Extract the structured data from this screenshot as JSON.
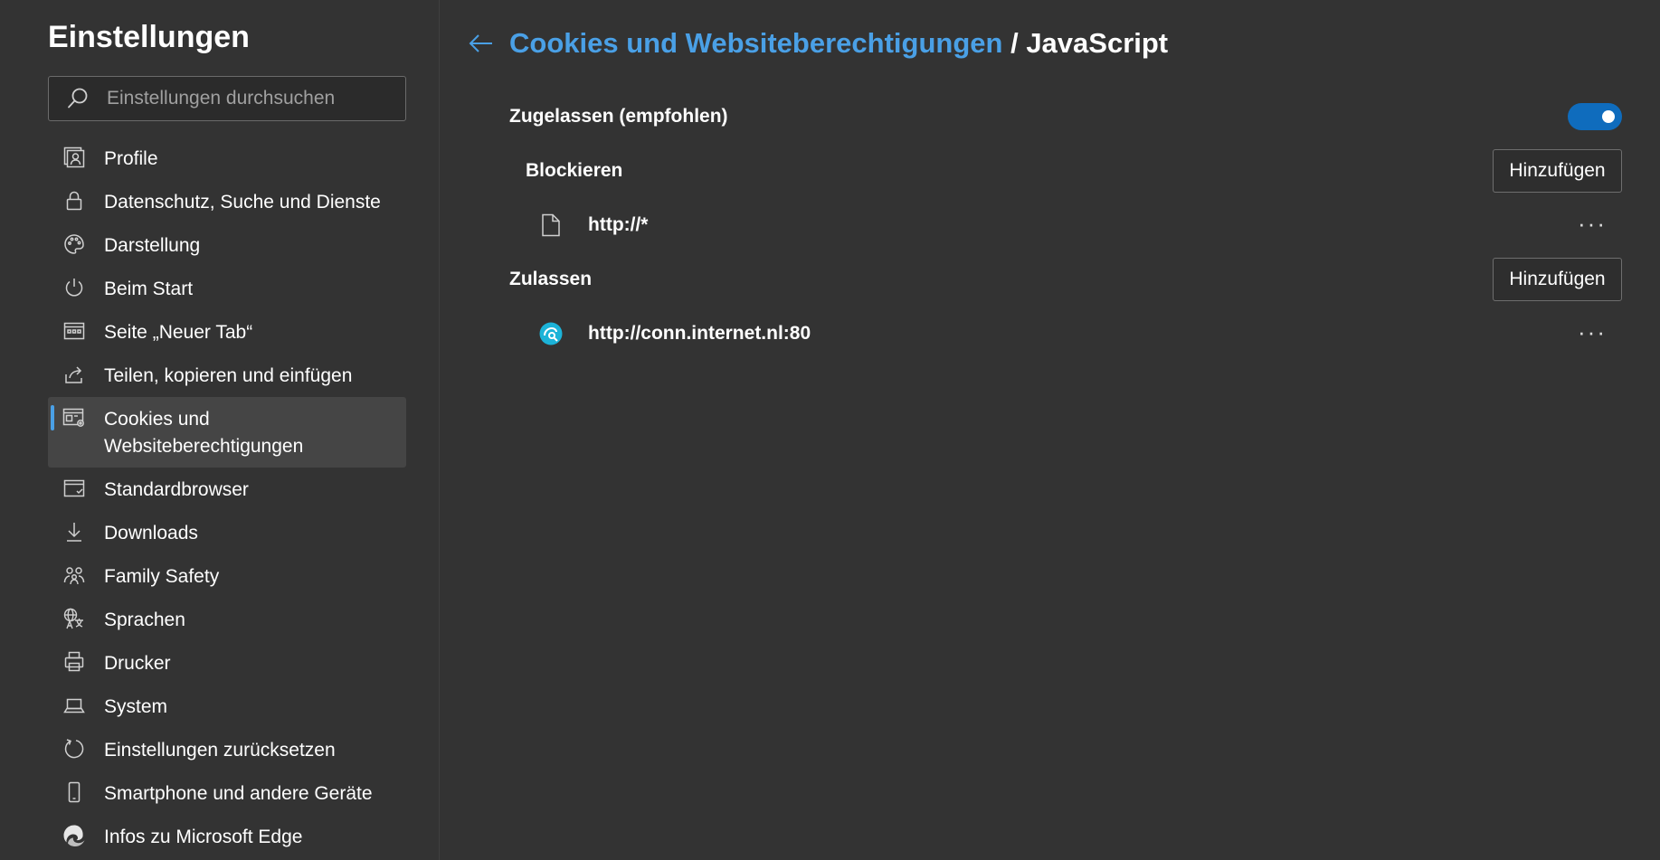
{
  "sidebar": {
    "title": "Einstellungen",
    "search_placeholder": "Einstellungen durchsuchen",
    "items": [
      {
        "label": "Profile",
        "icon": "profile-icon"
      },
      {
        "label": "Datenschutz, Suche und Dienste",
        "icon": "lock-icon"
      },
      {
        "label": "Darstellung",
        "icon": "palette-icon"
      },
      {
        "label": "Beim Start",
        "icon": "power-icon"
      },
      {
        "label": "Seite „Neuer Tab“",
        "icon": "new-tab-icon"
      },
      {
        "label": "Teilen, kopieren und einfügen",
        "icon": "share-icon"
      },
      {
        "label": "Cookies und Websiteberechtigungen",
        "icon": "cookies-icon",
        "active": true
      },
      {
        "label": "Standardbrowser",
        "icon": "default-browser-icon"
      },
      {
        "label": "Downloads",
        "icon": "download-icon"
      },
      {
        "label": "Family Safety",
        "icon": "family-icon"
      },
      {
        "label": "Sprachen",
        "icon": "language-icon"
      },
      {
        "label": "Drucker",
        "icon": "printer-icon"
      },
      {
        "label": "System",
        "icon": "laptop-icon"
      },
      {
        "label": "Einstellungen zurücksetzen",
        "icon": "reset-icon"
      },
      {
        "label": "Smartphone und andere Geräte",
        "icon": "phone-icon"
      },
      {
        "label": "Infos zu Microsoft Edge",
        "icon": "edge-icon"
      }
    ]
  },
  "main": {
    "breadcrumb_parent": "Cookies und Websiteberechtigungen",
    "breadcrumb_separator": "/",
    "breadcrumb_current": "JavaScript",
    "allowed_label": "Zugelassen (empfohlen)",
    "allowed_toggle_on": true,
    "block": {
      "label": "Blockieren",
      "add_label": "Hinzufügen",
      "sites": [
        {
          "url": "http://*",
          "icon": "file-icon"
        }
      ]
    },
    "allow": {
      "label": "Zulassen",
      "add_label": "Hinzufügen",
      "sites": [
        {
          "url": "http://conn.internet.nl:80",
          "icon": "site-favicon-icon"
        }
      ]
    },
    "more_label": "···"
  },
  "colors": {
    "background": "#333333",
    "accent": "#4aa0e6",
    "toggle_on": "#0f6cbd"
  }
}
